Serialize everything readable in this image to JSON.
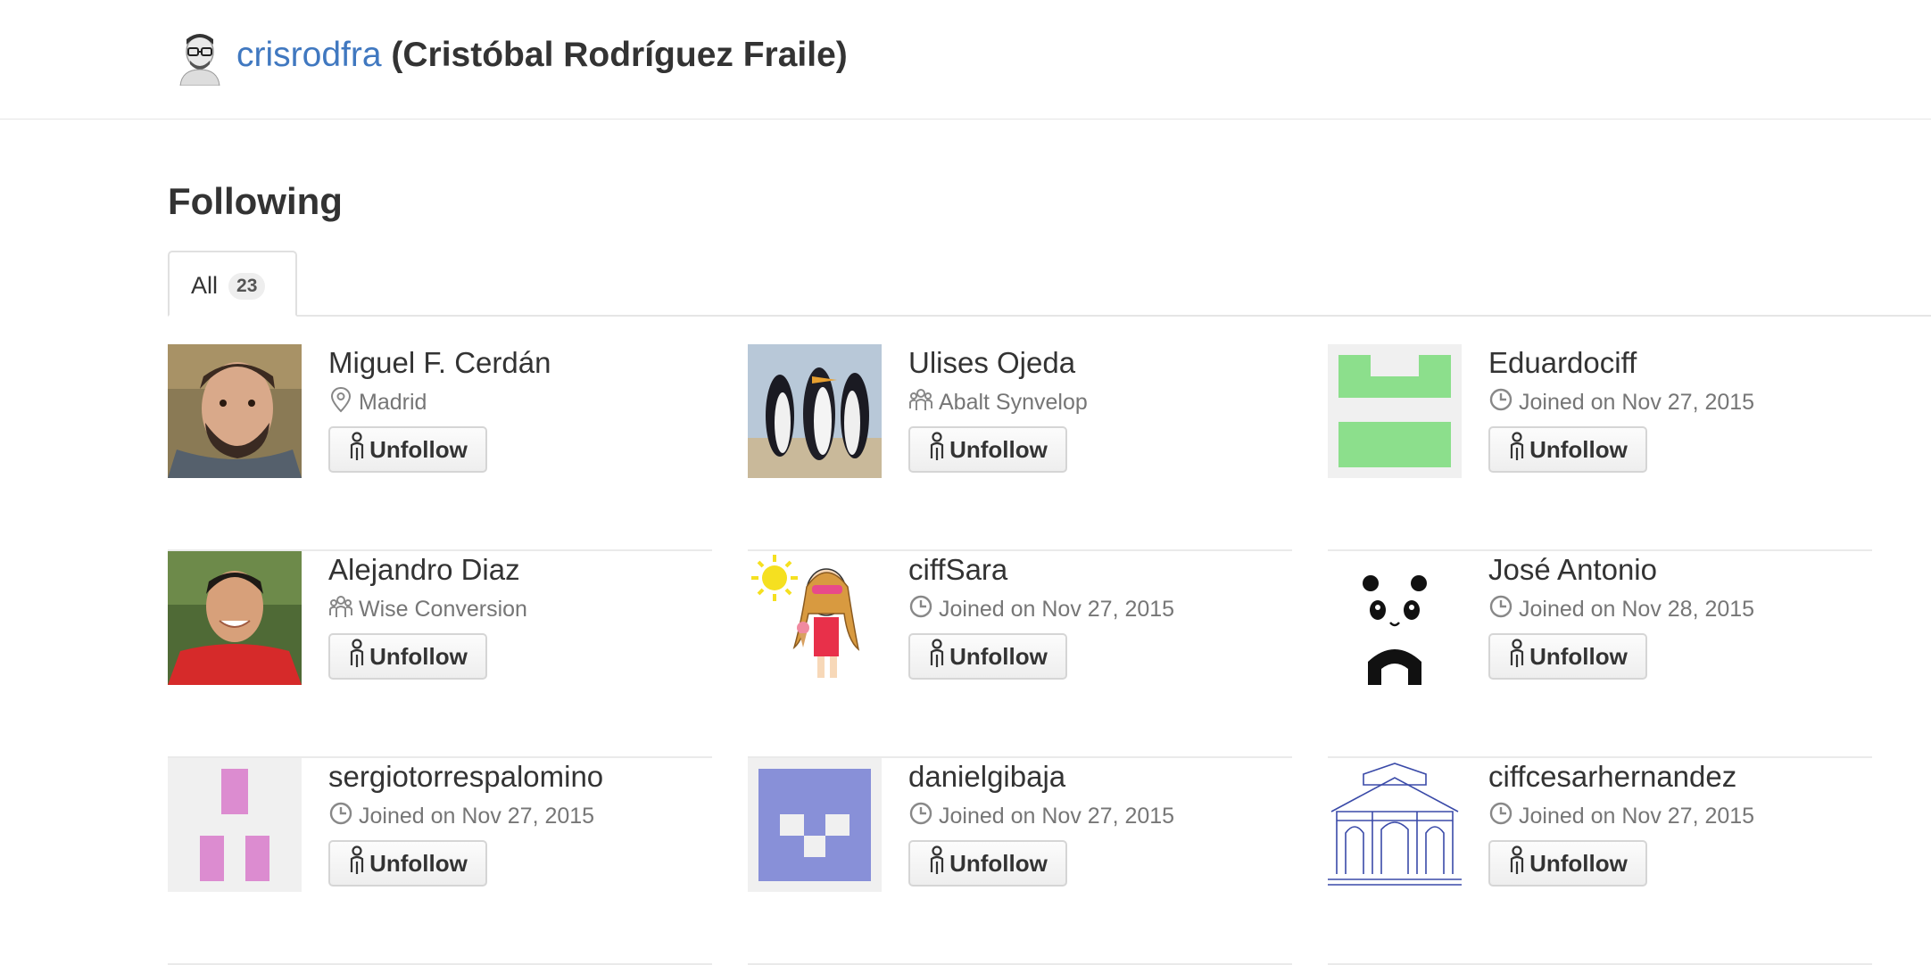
{
  "header": {
    "username": "crisrodfra",
    "fullname": "(Cristóbal Rodríguez Fraile)"
  },
  "page": {
    "heading": "Following",
    "tabs": [
      {
        "label": "All",
        "count": "23"
      }
    ]
  },
  "button_label": "Unfollow",
  "users": [
    {
      "name": "Miguel F. Cerdán",
      "meta": "Madrid",
      "meta_icon": "location-icon",
      "avatar": "photo-man-beard"
    },
    {
      "name": "Ulises Ojeda",
      "meta": "Abalt Synvelop",
      "meta_icon": "organization-icon",
      "avatar": "penguins"
    },
    {
      "name": "Eduardociff",
      "meta": "Joined on Nov 27, 2015",
      "meta_icon": "clock-icon",
      "avatar": "identicon-green"
    },
    {
      "name": "Alejandro Diaz",
      "meta": "Wise Conversion",
      "meta_icon": "organization-icon",
      "avatar": "photo-man-red-shirt"
    },
    {
      "name": "ciffSara",
      "meta": "Joined on Nov 27, 2015",
      "meta_icon": "clock-icon",
      "avatar": "cartoon-girl"
    },
    {
      "name": "José Antonio",
      "meta": "Joined on Nov 28, 2015",
      "meta_icon": "clock-icon",
      "avatar": "panda"
    },
    {
      "name": "sergiotorrespalomino",
      "meta": "Joined on Nov 27, 2015",
      "meta_icon": "clock-icon",
      "avatar": "identicon-pink"
    },
    {
      "name": "danielgibaja",
      "meta": "Joined on Nov 27, 2015",
      "meta_icon": "clock-icon",
      "avatar": "identicon-blue"
    },
    {
      "name": "ciffcesarhernandez",
      "meta": "Joined on Nov 27, 2015",
      "meta_icon": "clock-icon",
      "avatar": "building-sketch"
    }
  ],
  "colors": {
    "link": "#4078c0",
    "identicon_green": "#8cdf8c",
    "identicon_pink": "#dc8cd0",
    "identicon_blue": "#8890d8"
  }
}
